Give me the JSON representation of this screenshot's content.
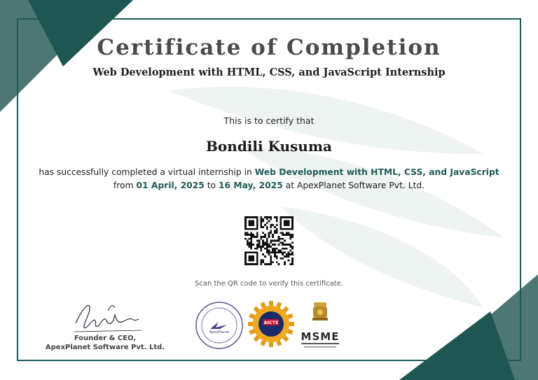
{
  "certificate": {
    "title": "Certificate of Completion",
    "subtitle": "Web Development with HTML, CSS, and JavaScript Internship",
    "certify_text": "This is to certify that",
    "recipient_name": "Bondili Kusuma",
    "completion_text_1": "has successfully completed a virtual internship in ",
    "program_name": "Web Development with HTML, CSS, and JavaScript",
    "from_text": "from ",
    "start_date": "01 April, 2025",
    "to_text": " to ",
    "end_date": "16 May, 2025",
    "company_text": " at ApexPlanet Software Pvt. Ltd.",
    "scan_text": "Scan the QR code to verify this certificate."
  },
  "signature": {
    "role": "Founder & CEO,",
    "company": "ApexPlanet Software Pvt. Ltd."
  },
  "logos": {
    "apexplanet_ring_text": "APEXPLANET SOFTWARE PVT. LTD.",
    "apexplanet_brand": "ApexPlanet",
    "aicte_label": "AICTE",
    "msme_label": "MSME"
  },
  "colors": {
    "accent": "#1f5a56",
    "corner_dark": "#1d5652",
    "corner_light": "#4d7773"
  }
}
